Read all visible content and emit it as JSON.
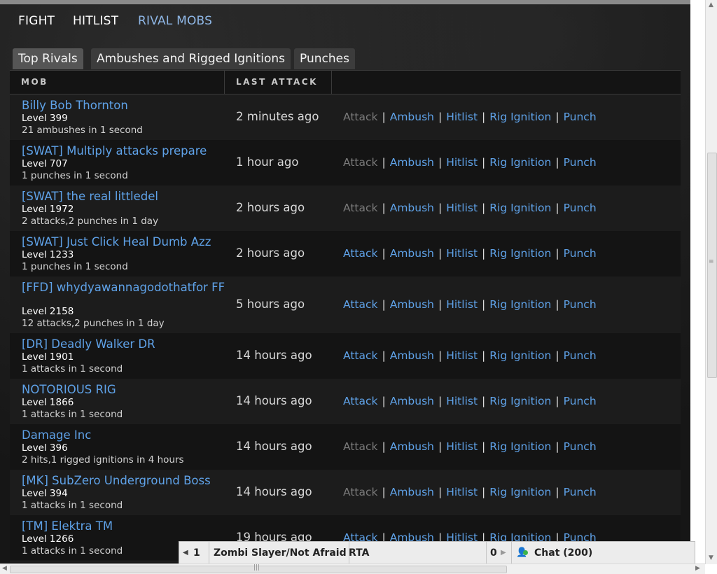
{
  "nav": {
    "fight": "FIGHT",
    "hitlist": "HITLIST",
    "rival_mobs": "RIVAL MOBS"
  },
  "tabs": [
    "Top Rivals",
    "Ambushes and Rigged Ignitions",
    "Punches"
  ],
  "table": {
    "col_mob": "MOB",
    "col_last_attack": "LAST ATTACK",
    "action_labels": [
      "Attack",
      "Ambush",
      "Hitlist",
      "Rig Ignition",
      "Punch"
    ],
    "separator": "|",
    "rows": [
      {
        "name": "Billy Bob Thornton",
        "level": "Level 399",
        "stats": "21 ambushes in 1 second",
        "time": "2 minutes ago",
        "attack_disabled": true
      },
      {
        "name": "[SWAT] Multiply attacks prepare",
        "level": "Level 707",
        "stats": "1 punches in 1 second",
        "time": "1 hour ago",
        "attack_disabled": true
      },
      {
        "name": "[SWAT] the real littledel",
        "level": "Level 1972",
        "stats": "2 attacks,2 punches in 1 day",
        "time": "2 hours ago",
        "attack_disabled": true
      },
      {
        "name": "[SWAT] Just Click Heal Dumb Azz",
        "level": "Level 1233",
        "stats": "1 punches in 1 second",
        "time": "2 hours ago",
        "attack_disabled": false
      },
      {
        "name": "[FFD] whydyawannagodothatfor FF",
        "level": "Level 2158",
        "stats": "12 attacks,2 punches in 1 day",
        "time": "5 hours ago",
        "attack_disabled": false
      },
      {
        "name": "[DR] Deadly Walker DR",
        "level": "Level 1901",
        "stats": "1 attacks in 1 second",
        "time": "14 hours ago",
        "attack_disabled": false
      },
      {
        "name": "NOTORIOUS RIG",
        "level": "Level 1866",
        "stats": "1 attacks in 1 second",
        "time": "14 hours ago",
        "attack_disabled": false
      },
      {
        "name": "Damage Inc",
        "level": "Level 396",
        "stats": "2 hits,1 rigged ignitions in 4 hours",
        "time": "14 hours ago",
        "attack_disabled": true
      },
      {
        "name": "[MK] SubZero Underground Boss",
        "level": "Level 394",
        "stats": "1 attacks in 1 second",
        "time": "14 hours ago",
        "attack_disabled": true
      },
      {
        "name": "[TM] Elektra TM",
        "level": "Level 1266",
        "stats": "1 attacks in 1 second",
        "time": "19 hours ago",
        "attack_disabled": false
      }
    ]
  },
  "chatbar": {
    "page_count": "1",
    "player_name": "Zombi Slayer/Not Afraid",
    "tag": "RTA",
    "next_count": "0",
    "chat_label": "Chat (200)"
  },
  "scrollbar": {
    "grip": "|||",
    "right_grip": "≡"
  },
  "colors": {
    "link": "#5fa2e8",
    "disabled": "#7a7a7a",
    "active_nav": "#8fb7e6",
    "online": "#3cb44b"
  }
}
